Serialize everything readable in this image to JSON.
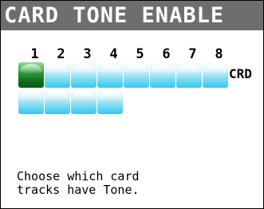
{
  "header": {
    "title": "CARD TONE ENABLE"
  },
  "tracks": {
    "numbers": [
      "1",
      "2",
      "3",
      "4",
      "5",
      "6",
      "7",
      "8"
    ],
    "row_label": "CRD",
    "row1_states": [
      "on",
      "off",
      "off",
      "off",
      "off",
      "off",
      "off",
      "off"
    ],
    "row2_states": [
      "off",
      "off",
      "off",
      "off"
    ]
  },
  "message": {
    "line1": "Choose which card",
    "line2": "tracks have Tone."
  },
  "colors": {
    "title_bar": "#6e6e6e",
    "tile_off": "#33c8ee",
    "tile_on": "#0e6b1f"
  }
}
